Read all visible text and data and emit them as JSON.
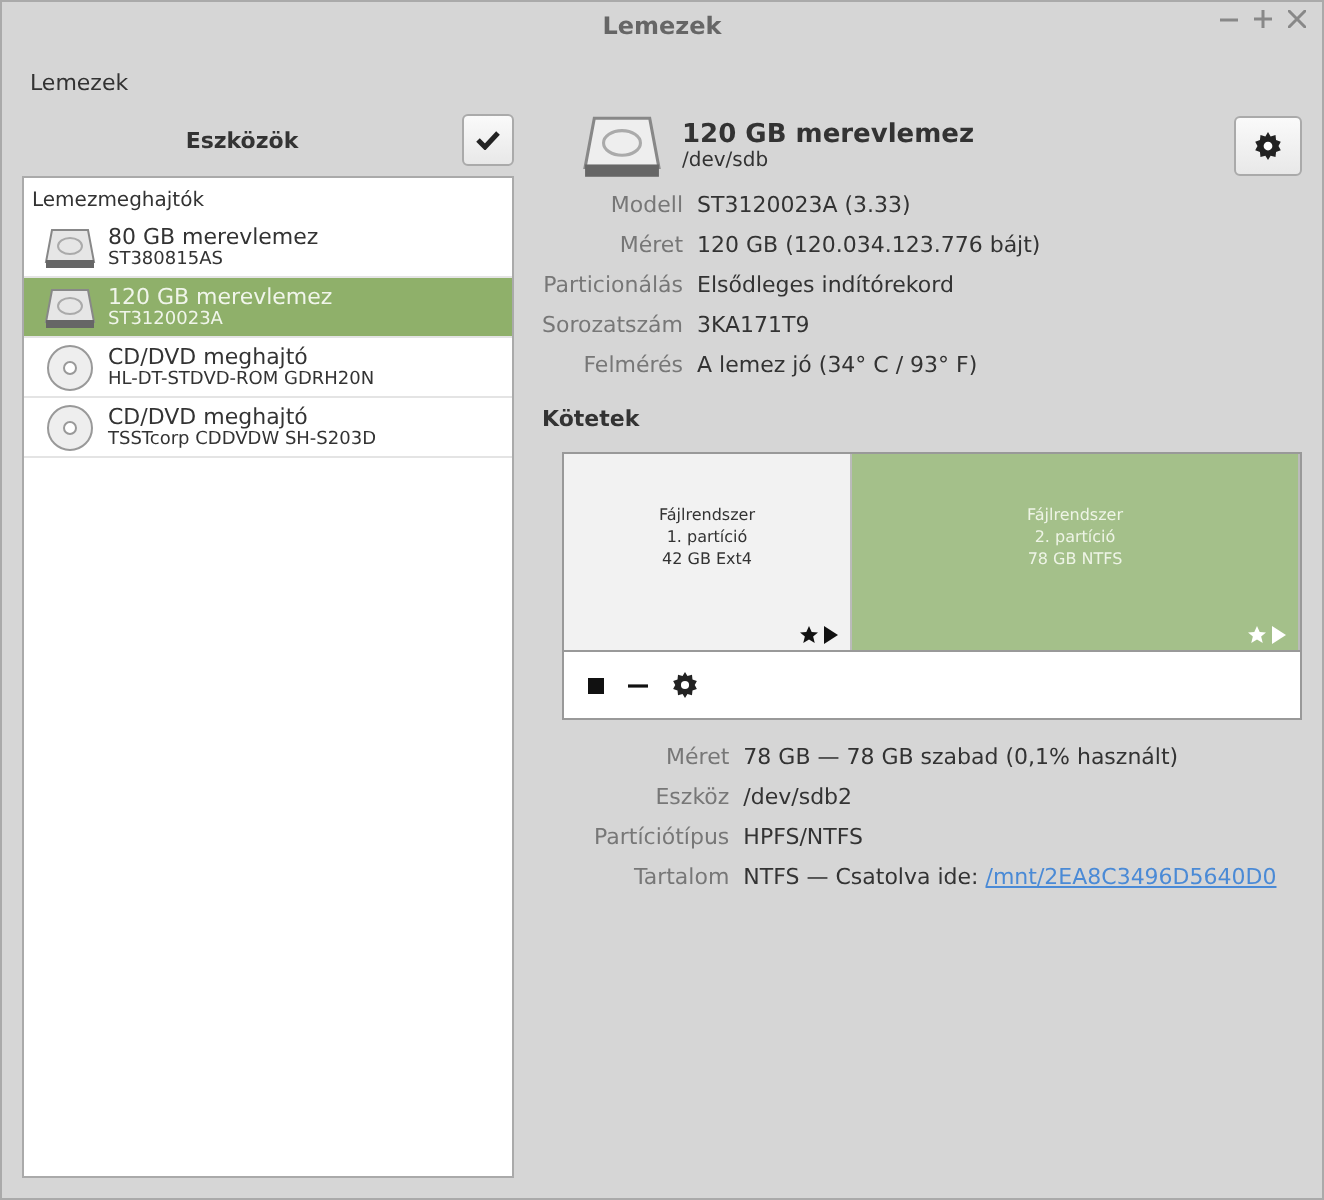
{
  "window": {
    "title": "Lemezek"
  },
  "menu": [
    "Lemezek"
  ],
  "devices_header": {
    "title": "Eszközök"
  },
  "devices": {
    "group": "Lemezmeghajtók",
    "items": [
      {
        "kind": "disk",
        "name": "80 GB merevlemez",
        "model": "ST380815AS",
        "selected": false
      },
      {
        "kind": "disk",
        "name": "120 GB merevlemez",
        "model": "ST3120023A",
        "selected": true
      },
      {
        "kind": "optical",
        "name": "CD/DVD meghajtó",
        "model": "HL-DT-STDVD-ROM GDRH20N",
        "selected": false
      },
      {
        "kind": "optical",
        "name": "CD/DVD meghajtó",
        "model": "TSSTcorp CDDVDW SH-S203D",
        "selected": false
      }
    ]
  },
  "drive": {
    "name": "120 GB merevlemez",
    "path": "/dev/sdb",
    "properties": [
      {
        "label": "Modell",
        "value": "ST3120023A (3.33)"
      },
      {
        "label": "Méret",
        "value": "120 GB (120.034.123.776 bájt)"
      },
      {
        "label": "Particionálás",
        "value": "Elsődleges indítórekord"
      },
      {
        "label": "Sorozatszám",
        "value": "3KA171T9"
      },
      {
        "label": "Felmérés",
        "value": "A lemez jó (34° C / 93° F)"
      }
    ]
  },
  "volumes": {
    "title": "Kötetek",
    "partitions": [
      {
        "lines": [
          "Fájlrendszer",
          "1. partíció",
          "42 GB Ext4"
        ],
        "selected": false
      },
      {
        "lines": [
          "Fájlrendszer",
          "2. partíció",
          "78 GB NTFS"
        ],
        "selected": true
      }
    ],
    "properties": [
      {
        "label": "Méret",
        "value": "78 GB — 78 GB szabad (0,1% használt)"
      },
      {
        "label": "Eszköz",
        "value": "/dev/sdb2"
      },
      {
        "label": "Partíciótípus",
        "value": "HPFS/NTFS"
      },
      {
        "label": "Tartalom",
        "value": "NTFS — Csatolva ide: ",
        "link": "/mnt/2EA8C3496D5640D0"
      }
    ]
  }
}
